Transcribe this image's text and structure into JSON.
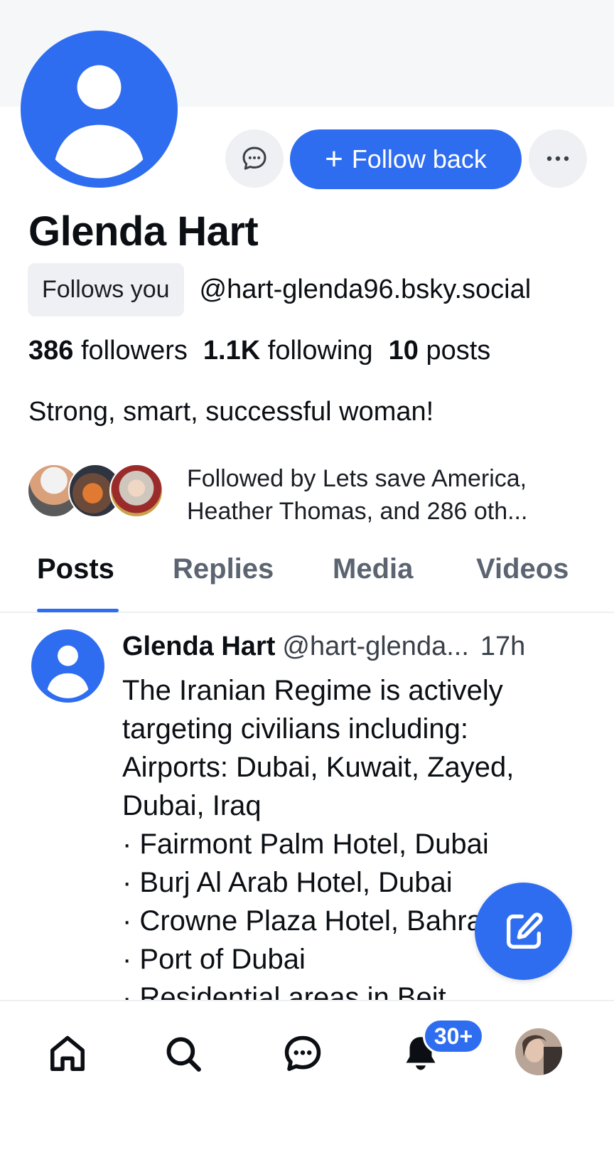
{
  "profile": {
    "display_name": "Glenda Hart",
    "follows_you_label": "Follows you",
    "handle": "@hart-glenda96.bsky.social",
    "stats": {
      "followers_count": "386",
      "followers_label": "followers",
      "following_count": "1.1K",
      "following_label": "following",
      "posts_count": "10",
      "posts_label": "posts"
    },
    "bio": "Strong, smart, successful woman!",
    "known_followers_text": "Followed by Lets save America, Heather Thomas, and 286 oth...",
    "avatar_icon": "default-avatar-icon"
  },
  "actions": {
    "message_icon": "chat-bubble-icon",
    "follow_back_label": "Follow back",
    "more_icon": "ellipsis-icon"
  },
  "tabs": [
    {
      "label": "Posts",
      "active": true
    },
    {
      "label": "Replies",
      "active": false
    },
    {
      "label": "Media",
      "active": false
    },
    {
      "label": "Videos",
      "active": false
    }
  ],
  "post": {
    "author_name": "Glenda Hart",
    "author_handle": "@hart-glenda...",
    "time": "17h",
    "text_lines": [
      "The Iranian Regime is actively",
      "targeting civilians including:",
      "Airports: Dubai, Kuwait, Zayed,",
      "Dubai, Iraq",
      "· Fairmont Palm Hotel, Dubai",
      "· Burj Al Arab Hotel, Dubai",
      "· Crowne Plaza Hotel, Bahrain",
      "· Port of Dubai",
      "· Residential areas in Beit"
    ]
  },
  "fab": {
    "icon": "compose-icon"
  },
  "bottom_nav": {
    "items": [
      "home-icon",
      "search-icon",
      "chat-icon",
      "bell-icon",
      "profile-avatar"
    ],
    "notifications_badge": "30+"
  },
  "colors": {
    "accent": "#2f6df0",
    "banner": "#f6f7f9",
    "chip_bg": "#eef0f3",
    "text_primary": "#0b0f14",
    "text_secondary": "#5b6470"
  }
}
